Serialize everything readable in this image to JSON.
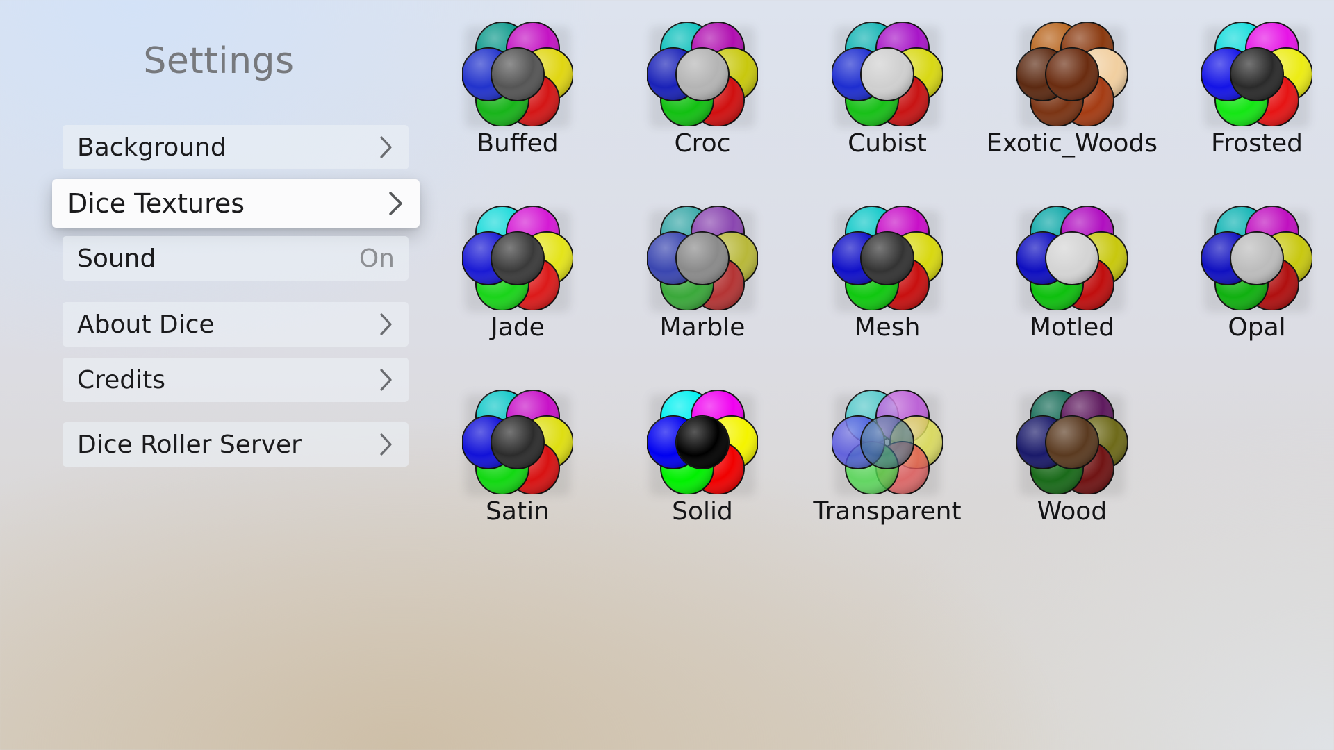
{
  "sidebar": {
    "title": "Settings",
    "items": [
      {
        "label": "Background",
        "value": ""
      },
      {
        "label": "Dice Textures",
        "value": ""
      },
      {
        "label": "Sound",
        "value": "On"
      },
      {
        "label": "About Dice",
        "value": ""
      },
      {
        "label": "Credits",
        "value": ""
      },
      {
        "label": "Dice Roller Server",
        "value": ""
      }
    ]
  },
  "textures": [
    {
      "name": "Buffed",
      "icon": "buffed-texture-icon",
      "colors": [
        "#0e9a8c",
        "#c414c4",
        "#e0d612",
        "#d41616",
        "#18b41a",
        "#2233cc",
        "#555555"
      ]
    },
    {
      "name": "Croc",
      "icon": "croc-texture-icon",
      "colors": [
        "#0ec0bc",
        "#b00fb0",
        "#c8c80e",
        "#d01010",
        "#12c012",
        "#1a22b8",
        "#b4b4b4"
      ]
    },
    {
      "name": "Cubist",
      "icon": "cubist-texture-icon",
      "colors": [
        "#14b4b4",
        "#a816c8",
        "#d8d814",
        "#c81414",
        "#18c018",
        "#1e2ed0",
        "#cfcfcf"
      ]
    },
    {
      "name": "Exotic_Woods",
      "icon": "exotic-woods-texture-icon",
      "colors": [
        "#b8651e",
        "#8a3a10",
        "#f1cfa0",
        "#a43c14",
        "#7a3414",
        "#5c2a12",
        "#6a2c10"
      ]
    },
    {
      "name": "Frosted",
      "icon": "frosted-texture-icon",
      "colors": [
        "#14dcdc",
        "#e614e6",
        "#ecec14",
        "#e61414",
        "#14e614",
        "#1414e6",
        "#2a2a2a"
      ]
    },
    {
      "name": "Jade",
      "icon": "jade-texture-icon",
      "colors": [
        "#1adada",
        "#d41ad4",
        "#e4e41a",
        "#dc1a1a",
        "#1ad41a",
        "#1a1ad4",
        "#3a3a3a"
      ]
    },
    {
      "name": "Marble",
      "icon": "marble-texture-icon",
      "colors": [
        "#3aa8a8",
        "#8a46b0",
        "#b8b83a",
        "#b43434",
        "#3aa83a",
        "#3a46b0",
        "#8a8a8a"
      ]
    },
    {
      "name": "Mesh",
      "icon": "mesh-texture-icon",
      "colors": [
        "#10c8c8",
        "#c810c8",
        "#d8d810",
        "#c81010",
        "#10c810",
        "#1010c8",
        "#333333"
      ]
    },
    {
      "name": "Motled",
      "icon": "motled-texture-icon",
      "colors": [
        "#0ea8a8",
        "#b00ec0",
        "#c8c80e",
        "#c00e0e",
        "#0ec00e",
        "#0e0ec0",
        "#d4d4d4"
      ]
    },
    {
      "name": "Opal",
      "icon": "opal-texture-icon",
      "colors": [
        "#10b4b4",
        "#c010c0",
        "#c8c810",
        "#b01010",
        "#10b010",
        "#1010c0",
        "#bcbcbc"
      ]
    },
    {
      "name": "Satin",
      "icon": "satin-texture-icon",
      "colors": [
        "#12c8c8",
        "#c812c8",
        "#dede12",
        "#d81212",
        "#12d812",
        "#1212d8",
        "#2c2c2c"
      ]
    },
    {
      "name": "Solid",
      "icon": "solid-texture-icon",
      "colors": [
        "#00f0f0",
        "#f000f0",
        "#f4f400",
        "#f00000",
        "#00f000",
        "#0000f0",
        "#000000"
      ]
    },
    {
      "name": "Transparent",
      "icon": "transparent-texture-icon",
      "colors": [
        "#36c8c8",
        "#b846d8",
        "#dede46",
        "#e05050",
        "#46d846",
        "#4646e0",
        "#3a6a8a"
      ]
    },
    {
      "name": "Wood",
      "icon": "wood-texture-icon",
      "colors": [
        "#1a6e5a",
        "#5e1a5e",
        "#6e6a1a",
        "#701414",
        "#1a6a1a",
        "#1a1a6a",
        "#5a3a20"
      ]
    }
  ]
}
